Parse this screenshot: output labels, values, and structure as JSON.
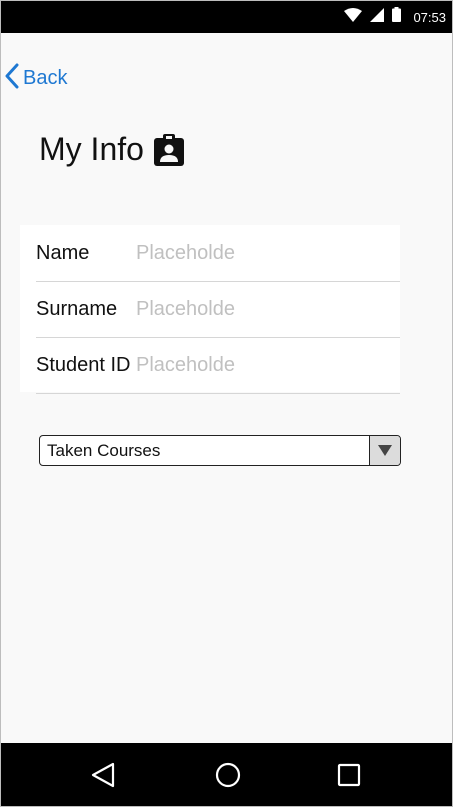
{
  "status_bar": {
    "time": "07:53",
    "icons": [
      "wifi-icon",
      "cell-signal-icon",
      "battery-icon"
    ]
  },
  "navigation": {
    "back_label": "Back",
    "back_icon": "chevron-left-icon"
  },
  "header": {
    "title": "My Info",
    "title_icon": "contact-badge-icon"
  },
  "form": {
    "fields": [
      {
        "label": "Name",
        "value": "",
        "placeholder": "Placeholde"
      },
      {
        "label": "Surname",
        "value": "",
        "placeholder": "Placeholde"
      },
      {
        "label": "Student ID",
        "value": "",
        "placeholder": "Placeholde"
      }
    ]
  },
  "courses_dropdown": {
    "selected": "Taken Courses",
    "arrow_icon": "triangle-down-icon"
  },
  "system_nav": {
    "buttons": [
      "back-triangle-icon",
      "home-circle-icon",
      "recents-square-icon"
    ]
  },
  "colors": {
    "accent": "#1e78d2",
    "background": "#f9f9f9",
    "system_bars": "#000000"
  }
}
